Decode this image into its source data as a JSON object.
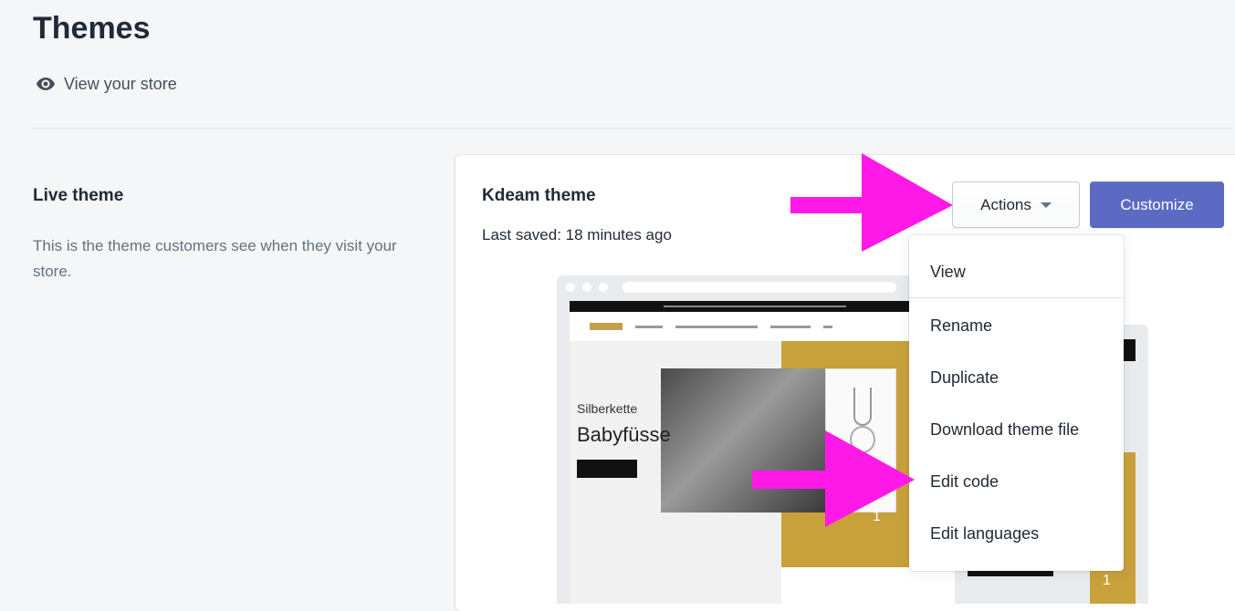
{
  "header": {
    "title": "Themes",
    "view_store_label": "View your store"
  },
  "live_theme": {
    "title": "Live theme",
    "description": "This is the theme customers see when they visit your store."
  },
  "theme_card": {
    "name": "Kdeam theme",
    "last_saved": "Last saved: 18 minutes ago",
    "actions_label": "Actions",
    "customize_label": "Customize"
  },
  "preview": {
    "hero_subtitle": "Silberkette",
    "hero_title": "Babyfüsse",
    "slide_number": "1",
    "slide_number_2": "1"
  },
  "actions_menu": {
    "items": [
      "View",
      "Rename",
      "Duplicate",
      "Download theme file",
      "Edit code",
      "Edit languages"
    ]
  },
  "colors": {
    "accent": "#5c6ac4",
    "annotation_arrow": "#ff19e6",
    "background": "#f4f6f8"
  },
  "icons": {
    "view_store": "eye-icon",
    "actions_caret": "caret-down-icon"
  }
}
